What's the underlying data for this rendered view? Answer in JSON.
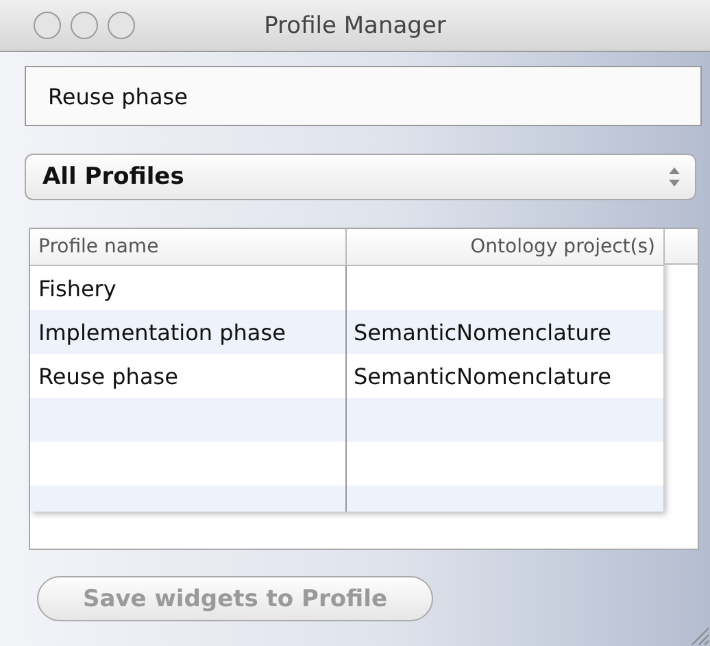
{
  "window": {
    "title": "Profile Manager"
  },
  "name_field": {
    "value": "Reuse phase"
  },
  "profile_filter": {
    "value": "All Profiles"
  },
  "table": {
    "columns": [
      "Profile name",
      "Ontology project(s)"
    ],
    "rows": [
      {
        "profile_name": "Fishery",
        "ontology_projects": ""
      },
      {
        "profile_name": "Implementation phase",
        "ontology_projects": "SemanticNomenclature"
      },
      {
        "profile_name": "Reuse phase",
        "ontology_projects": "SemanticNomenclature"
      }
    ]
  },
  "save_button": {
    "label": "Save widgets to Profile",
    "disabled": true
  }
}
